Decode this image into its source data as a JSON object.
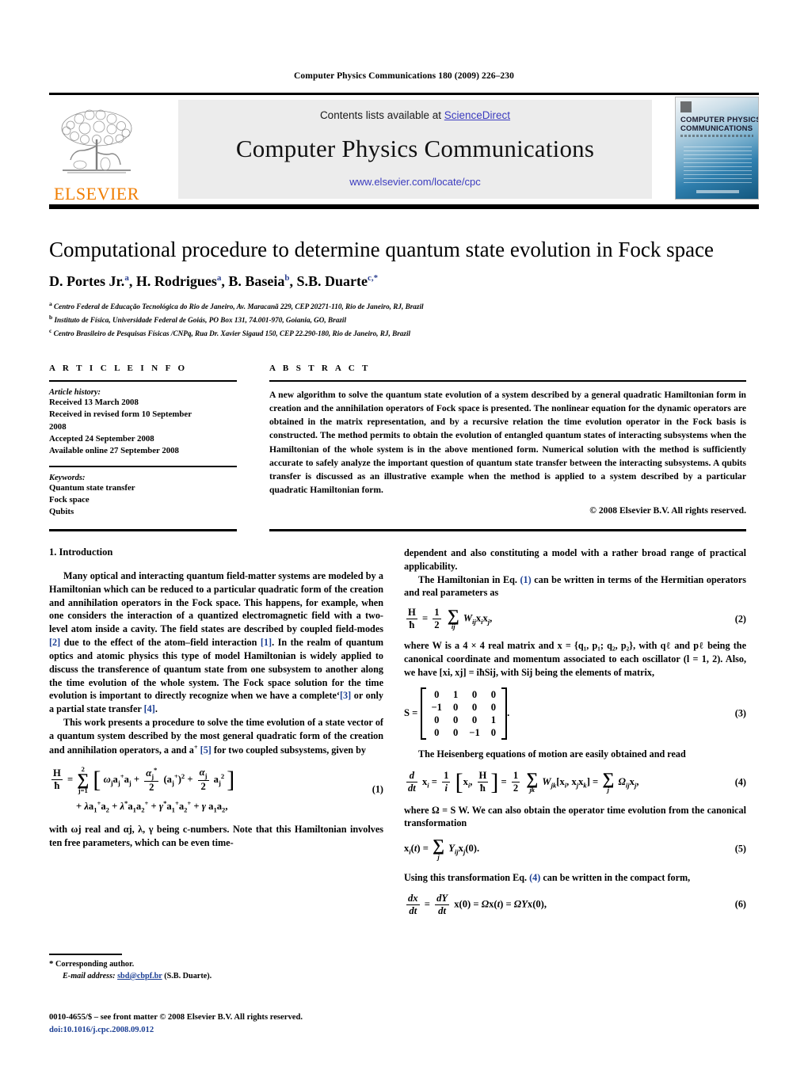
{
  "running_head": "Computer Physics Communications 180 (2009) 226–230",
  "header": {
    "contents_prefix": "Contents lists available at ",
    "sciencedirect": "ScienceDirect",
    "journal_title": "Computer Physics Communications",
    "journal_url": "www.elsevier.com/locate/cpc",
    "publisher_logo_text": "ELSEVIER",
    "cover_line1": "COMPUTER PHYSICS",
    "cover_line2": "COMMUNICATIONS",
    "link_color": "#3b3bbf",
    "elsevier_orange": "#F07D00"
  },
  "article": {
    "title": "Computational procedure to determine quantum state evolution in Fock space",
    "authors": [
      {
        "name": "D. Portes Jr.",
        "marks": "a"
      },
      {
        "name": "H. Rodrigues",
        "marks": "a"
      },
      {
        "name": "B. Baseia",
        "marks": "b"
      },
      {
        "name": "S.B. Duarte",
        "marks": "c,*"
      }
    ],
    "authors_line": "D. Portes Jr. a, H. Rodrigues a, B. Baseia b, S.B. Duarte c,*",
    "affiliations": [
      {
        "mark": "a",
        "text": "Centro Federal de Educação Tecnológica do Rio de Janeiro, Av. Maracanã 229, CEP 20271-110, Rio de Janeiro, RJ, Brazil"
      },
      {
        "mark": "b",
        "text": "Instituto de Física, Universidade Federal de Goiás, PO Box 131, 74.001-970, Goiania, GO, Brazil"
      },
      {
        "mark": "c",
        "text": "Centro Brasileiro de Pesquisas Físicas /CNPq, Rua Dr. Xavier Sigaud 150, CEP 22.290-180, Rio de Janeiro, RJ, Brazil"
      }
    ]
  },
  "info": {
    "heading": "A R T I C L E    I N F O",
    "history_label": "Article history:",
    "history": [
      "Received 13 March 2008",
      "Received in revised form 10 September",
      "2008",
      "Accepted 24 September 2008",
      "Available online 27 September 2008"
    ],
    "keywords_label": "Keywords:",
    "keywords": [
      "Quantum state transfer",
      "Fock space",
      "Qubits"
    ]
  },
  "abstract": {
    "heading": "A B S T R A C T",
    "text": "A new algorithm to solve the quantum state evolution of a system described by a general quadratic Hamiltonian form in creation and the annihilation operators of Fock space is presented. The nonlinear equation for the dynamic operators are obtained in the matrix representation, and by a recursive relation the time evolution operator in the Fock basis is constructed. The method permits to obtain the evolution of entangled quantum states of interacting subsystems when the Hamiltonian of the whole system is in the above mentioned form. Numerical solution with the method is sufficiently accurate to safely analyze the important question of quantum state transfer between the interacting subsystems. A qubits transfer is discussed as an illustrative example when the method is applied to a system described by a particular quadratic Hamiltonian form.",
    "copyright": "© 2008 Elsevier B.V. All rights reserved."
  },
  "body": {
    "section1_number": "1.",
    "section1_title": "Introduction",
    "left_p1_a": "Many optical and interacting quantum field-matter systems are modeled by a Hamiltonian which can be reduced to a particular quadratic form of the creation and annihilation operators in the Fock space. This happens, for example, when one considers the interaction of a quantized electromagnetic field with a two-level atom inside a cavity. The field states are described by coupled field-modes ",
    "ref2": "[2]",
    "left_p1_b": " due to the effect of the atom–field interaction ",
    "ref1": "[1]",
    "left_p1_c": ". In the realm of quantum optics and atomic physics this type of model Hamiltonian is widely applied to discuss the transference of quantum state from one subsystem to another along the time evolution of the whole system. The Fock space solution for the time evolution is important to directly recognize when we have a complete‘",
    "ref3": "[3]",
    "left_p1_d": " or only a partial state transfer ",
    "ref4": "[4]",
    "left_p1_e": ".",
    "left_p2_a": "This work presents a procedure to solve the time evolution of a state vector of a quantum system described by the most general quadratic form of the creation and annihilation operators, a and a",
    "left_p2_sup": "+",
    "ref5": "[5]",
    "left_p2_b": " for two coupled subsystems, given by",
    "left_p3": "with ωj real and αj, λ, γ being c-numbers. Note that this Hamiltonian involves ten free parameters, which can be even time-",
    "right_p1": "dependent and also constituting a model with a rather broad range of practical applicability.",
    "right_p2_a": "The Hamiltonian in Eq. ",
    "ref_eq1": "(1)",
    "right_p2_b": " can be written in terms of the Hermitian operators and real parameters as",
    "right_p3": "where W is a 4 × 4 real matrix and x = {q₁, p₁; q₂, p₂}, with qℓ and pℓ being the canonical coordinate and momentum associated to each oscillator (l = 1, 2). Also, we have [xi, xj] = iħSij, with Sij being the elements of matrix,",
    "right_p4": "The Heisenberg equations of motion are easily obtained and read",
    "right_p5": "where Ω = S W. We can also obtain the operator time evolution from the canonical transformation",
    "right_p6_a": "Using this transformation Eq. ",
    "ref_eq4": "(4)",
    "right_p6_b": " can be written in the compact form,"
  },
  "equations": {
    "eq1_num": "(1)",
    "eq2_num": "(2)",
    "eq3_num": "(3)",
    "eq4_num": "(4)",
    "eq5_num": "(5)",
    "eq6_num": "(6)",
    "matrix_S": [
      [
        "0",
        "1",
        "0",
        "0"
      ],
      [
        "−1",
        "0",
        "0",
        "0"
      ],
      [
        "0",
        "0",
        "0",
        "1"
      ],
      [
        "0",
        "0",
        "−1",
        "0"
      ]
    ]
  },
  "footnote": {
    "star": "*",
    "corresponding": "Corresponding author.",
    "email_label": "E-mail address:",
    "email": "sbd@cbpf.br",
    "email_owner": "(S.B. Duarte)."
  },
  "footer": {
    "issn_line": "0010-4655/$ – see front matter  © 2008 Elsevier B.V. All rights reserved.",
    "doi": "doi:10.1016/j.cpc.2008.09.012"
  }
}
